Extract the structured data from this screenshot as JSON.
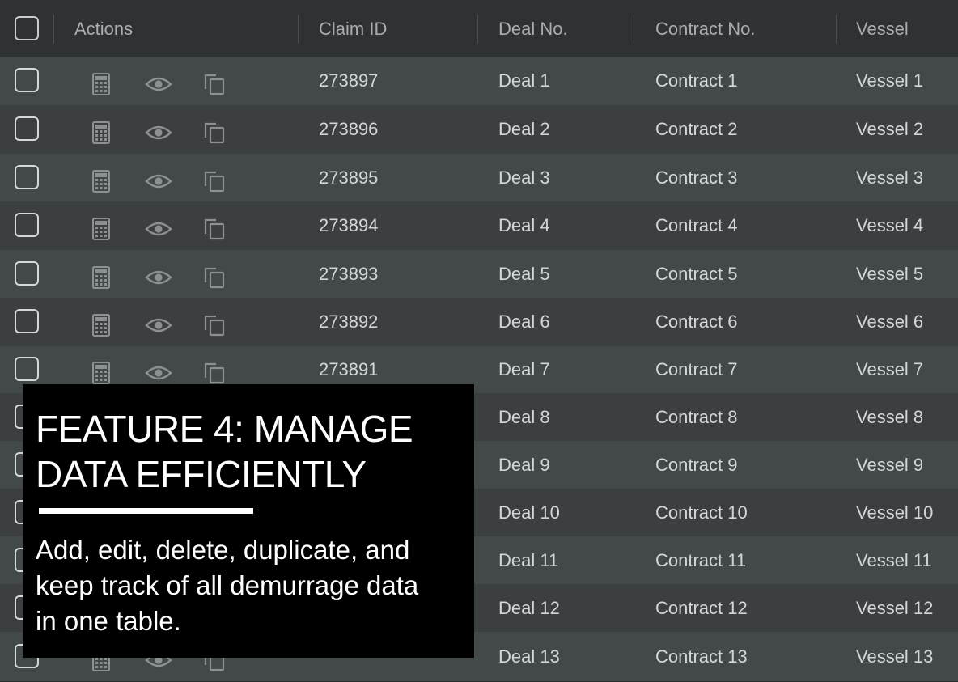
{
  "table": {
    "columns": [
      "Actions",
      "Claim ID",
      "Deal No.",
      "Contract No.",
      "Vessel"
    ],
    "rows": [
      {
        "claim_id": "273897",
        "deal": "Deal 1",
        "contract": "Contract 1",
        "vessel": "Vessel 1"
      },
      {
        "claim_id": "273896",
        "deal": "Deal 2",
        "contract": "Contract 2",
        "vessel": "Vessel 2"
      },
      {
        "claim_id": "273895",
        "deal": "Deal 3",
        "contract": "Contract 3",
        "vessel": "Vessel 3"
      },
      {
        "claim_id": "273894",
        "deal": "Deal 4",
        "contract": "Contract 4",
        "vessel": "Vessel 4"
      },
      {
        "claim_id": "273893",
        "deal": "Deal 5",
        "contract": "Contract 5",
        "vessel": "Vessel 5"
      },
      {
        "claim_id": "273892",
        "deal": "Deal 6",
        "contract": "Contract 6",
        "vessel": "Vessel 6"
      },
      {
        "claim_id": "273891",
        "deal": "Deal 7",
        "contract": "Contract 7",
        "vessel": "Vessel 7"
      },
      {
        "claim_id": "",
        "deal": "Deal 8",
        "contract": "Contract 8",
        "vessel": "Vessel 8"
      },
      {
        "claim_id": "",
        "deal": "Deal 9",
        "contract": "Contract 9",
        "vessel": "Vessel 9"
      },
      {
        "claim_id": "",
        "deal": "Deal 10",
        "contract": "Contract 10",
        "vessel": "Vessel 10"
      },
      {
        "claim_id": "",
        "deal": "Deal 11",
        "contract": "Contract 11",
        "vessel": "Vessel 11"
      },
      {
        "claim_id": "",
        "deal": "Deal 12",
        "contract": "Contract 12",
        "vessel": "Vessel 12"
      },
      {
        "claim_id": "",
        "deal": "Deal 13",
        "contract": "Contract 13",
        "vessel": "Vessel 13"
      }
    ],
    "row_action_icons": [
      "calculator-icon",
      "eye-icon",
      "duplicate-icon"
    ]
  },
  "feature_overlay": {
    "title_line1": "FEATURE 4: MANAGE",
    "title_line2": "DATA EFFICIENTLY",
    "description_line1": "Add, edit, delete, duplicate, and",
    "description_line2": "keep track of all demurrage data",
    "description_line3": "in one table."
  },
  "colors": {
    "header_bg": "#2f3233",
    "row_odd_bg": "#434849",
    "row_even_bg": "#3b3f40",
    "overlay_bg": "#000000",
    "text": "#d3d6d7"
  }
}
